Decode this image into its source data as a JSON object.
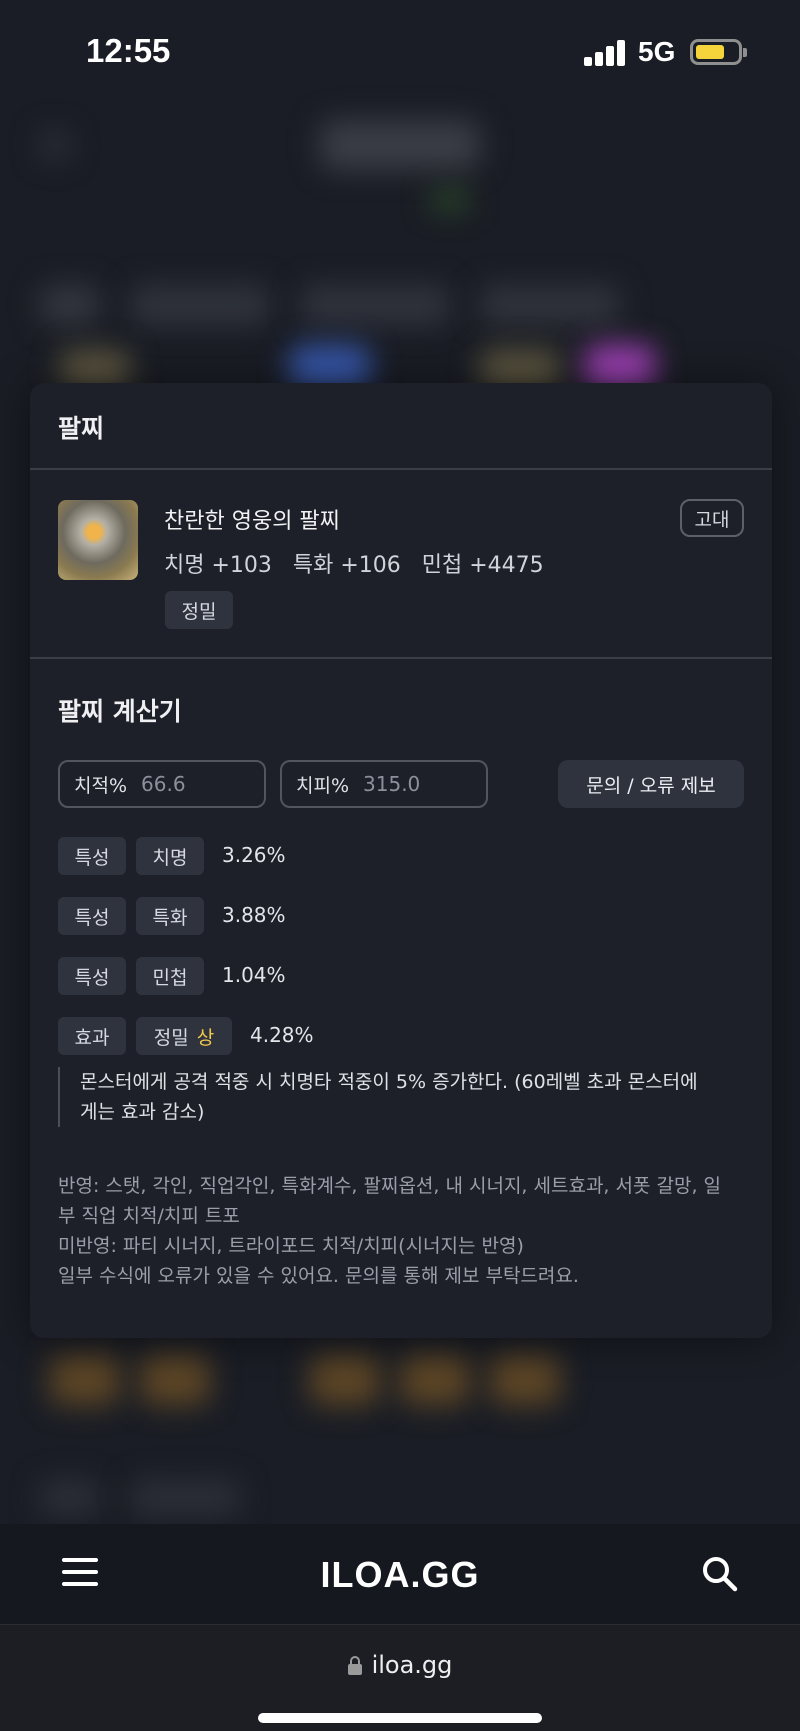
{
  "status_bar": {
    "time": "12:55",
    "network": "5G"
  },
  "modal": {
    "section_title": "팔찌",
    "item": {
      "name": "찬란한 영웅의 팔찌",
      "stats": "치명 +103   특화 +106   민첩 +4475",
      "tag": "정밀",
      "tier": "고대"
    },
    "calculator": {
      "title": "팔찌 계산기",
      "crit_rate": {
        "label": "치적%",
        "value": "66.6"
      },
      "crit_damage": {
        "label": "치피%",
        "value": "315.0"
      },
      "report_button": "문의 / 오류 제보",
      "rows": [
        {
          "type": "특성",
          "name": "치명",
          "value": "3.26%"
        },
        {
          "type": "특성",
          "name": "특화",
          "value": "3.88%"
        },
        {
          "type": "특성",
          "name": "민첩",
          "value": "1.04%"
        }
      ],
      "effect": {
        "type": "효과",
        "name": "정밀",
        "grade": "상",
        "value": "4.28%"
      },
      "effect_description": "몬스터에게 공격 적중 시 치명타 적중이 5% 증가한다. (60레벨 초과 몬스터에게는 효과 감소)",
      "notes": [
        "반영: 스탯, 각인, 직업각인, 특화계수, 팔찌옵션, 내 시너지, 세트효과, 서폿 갈망, 일부 직업 치적/치피 트포",
        "미반영: 파티 시너지, 트라이포드 치적/치피(시너지는 반영)",
        "일부 수식에 오류가 있을 수 있어요. 문의를 통해 제보 부탁드려요."
      ]
    }
  },
  "bottom_nav": {
    "logo": "ILOA.GG"
  },
  "url_bar": {
    "url": "iloa.gg"
  },
  "colors": {
    "accent_grade": "#f2c94c",
    "battery": "#f5d33b"
  }
}
